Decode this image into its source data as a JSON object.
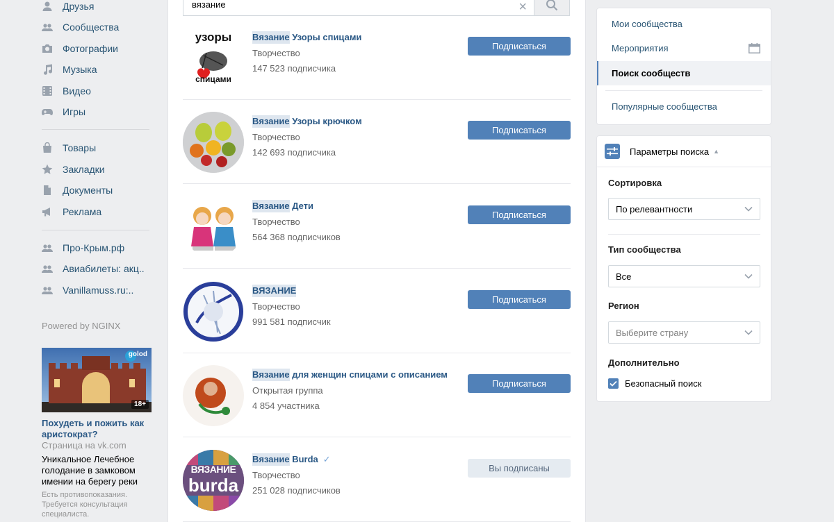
{
  "nav": {
    "items": [
      {
        "label": "Друзья",
        "icon": "friends-icon"
      },
      {
        "label": "Сообщества",
        "icon": "communities-icon"
      },
      {
        "label": "Фотографии",
        "icon": "camera-icon"
      },
      {
        "label": "Музыка",
        "icon": "music-icon"
      },
      {
        "label": "Видео",
        "icon": "video-icon"
      },
      {
        "label": "Игры",
        "icon": "gamepad-icon"
      },
      {
        "label": "Товары",
        "icon": "bag-icon"
      },
      {
        "label": "Закладки",
        "icon": "star-icon"
      },
      {
        "label": "Документы",
        "icon": "document-icon"
      },
      {
        "label": "Реклама",
        "icon": "megaphone-icon"
      },
      {
        "label": "Про-Крым.рф",
        "icon": "community-icon"
      },
      {
        "label": "Авиабилеты: акц..",
        "icon": "community-icon"
      },
      {
        "label": "Vanillamuss.ru:..",
        "icon": "community-icon"
      }
    ],
    "powered": "Powered by NGINX"
  },
  "ad": {
    "title": "Похудеть и пожить как аристократ?",
    "domain": "Страница на vk.com",
    "description": "Уникальное Лечебное голодание в замковом имении на берегу реки",
    "note": "Есть противопоказания. Требуется консультация специалиста.",
    "badge": "18+",
    "logo_text": "golod"
  },
  "search": {
    "value": "вязание",
    "clear_symbol": "×"
  },
  "groups": [
    {
      "highlight": "Вязание",
      "rest": " Узоры спицами",
      "type": "Творчество",
      "count": "147 523 подписчика",
      "button": "Подписаться",
      "subscribed": false,
      "verified": false,
      "avatar_text": [
        "узоры",
        "спицами"
      ]
    },
    {
      "highlight": "Вязание",
      "rest": " Узоры крючком",
      "type": "Творчество",
      "count": "142 693 подписчика",
      "button": "Подписаться",
      "subscribed": false,
      "verified": false
    },
    {
      "highlight": "Вязание",
      "rest": " Дети",
      "type": "Творчество",
      "count": "564 368 подписчиков",
      "button": "Подписаться",
      "subscribed": false,
      "verified": false
    },
    {
      "highlight": "ВЯЗАНИЕ",
      "rest": "",
      "type": "Творчество",
      "count": "991 581 подписчик",
      "button": "Подписаться",
      "subscribed": false,
      "verified": false
    },
    {
      "highlight": "Вязание",
      "rest": " для женщин спицами с описанием",
      "type": "Открытая группа",
      "count": "4 854 участника",
      "button": "Подписаться",
      "subscribed": false,
      "verified": false
    },
    {
      "highlight": "Вязание",
      "rest": " Burda",
      "type": "Творчество",
      "count": "251 028 подписчиков",
      "button": "Вы подписаны",
      "subscribed": true,
      "verified": true,
      "avatar_text": [
        "ВЯЗАНИЕ",
        "burda"
      ]
    }
  ],
  "right_menu": {
    "items": [
      {
        "label": "Мои сообщества"
      },
      {
        "label": "Мероприятия"
      },
      {
        "label": "Поиск сообществ"
      },
      {
        "label": "Популярные сообщества"
      }
    ]
  },
  "params": {
    "title": "Параметры поиска",
    "sort_label": "Сортировка",
    "sort_value": "По релевантности",
    "type_label": "Тип сообщества",
    "type_value": "Все",
    "region_label": "Регион",
    "region_placeholder": "Выберите страну",
    "extra_label": "Дополнительно",
    "safe_search_label": "Безопасный поиск",
    "safe_search_checked": true
  },
  "colors": {
    "accent": "#5181b8",
    "link": "#2a5885",
    "background": "#edeef0"
  }
}
